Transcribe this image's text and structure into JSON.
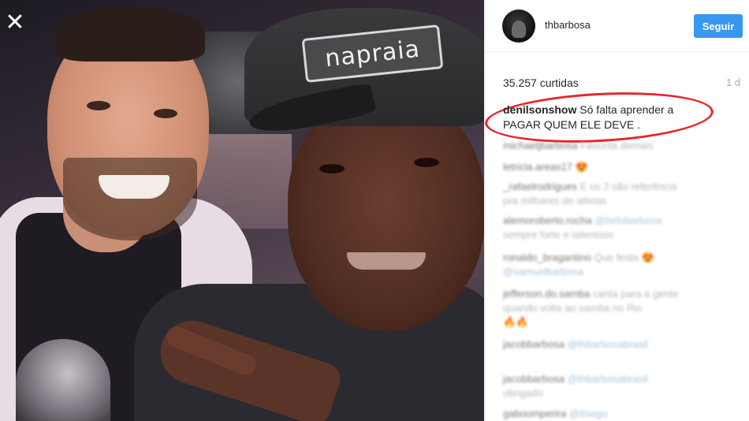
{
  "photo": {
    "cap_text": "napraia",
    "close_icon": "close-icon"
  },
  "panel": {
    "username": "thbarbosa",
    "follow_label": "Seguir",
    "likes": "35.257 curtidas",
    "time_ago": "1 d",
    "caption": {
      "user": "denilsonshow",
      "text_line1": "Só falta aprender a",
      "text_line2": "PAGAR QUEM ELE DEVE ."
    },
    "comments": [
      {
        "user": "michaeljbarbosa",
        "text": "Favorita demais"
      },
      {
        "user": "letricia.areas17",
        "text": "😍"
      },
      {
        "user": "_rafaelrodrigues",
        "text": "E os 2 são referência",
        "line2": "pra milhares de atletas"
      },
      {
        "user": "alemoroberto.rocha",
        "text": "@belobarbosa",
        "line2": "sempre forte e talentoso"
      },
      {
        "user": "ronaldo_bragantino",
        "text": "Que festa 😍",
        "line2": "@samuelbarbosa"
      },
      {
        "user": "jefferson.do.samba",
        "text": "canta para a gente",
        "line2": "quando volta ao samba no Rio",
        "line3": "🔥🔥"
      },
      {
        "user": "jacobbarbosa",
        "text": "@thbarbosabrasil"
      },
      {
        "user": "jacobbarbosa",
        "text": "@thbarbosabrasil",
        "line2": "obrigado"
      },
      {
        "user": "gaboomperira",
        "text": "@thiago"
      }
    ]
  }
}
